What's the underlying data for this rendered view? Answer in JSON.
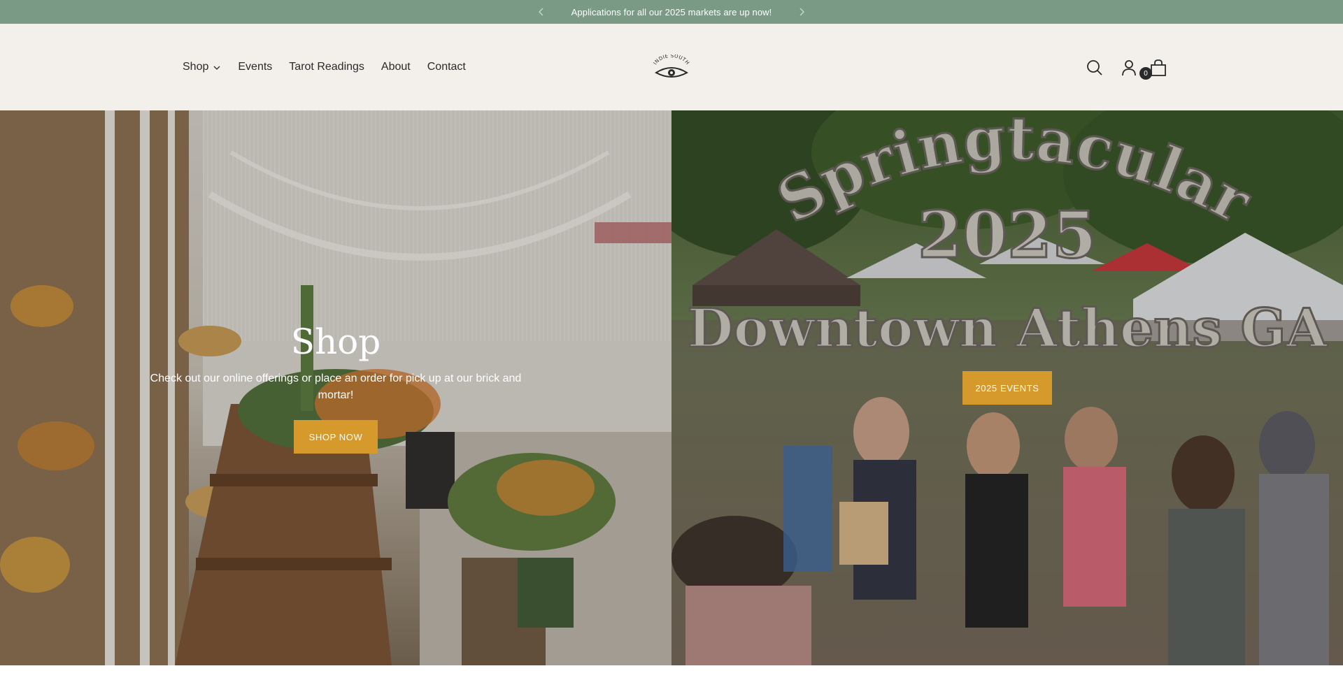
{
  "announcement": {
    "message": "Applications for all our 2025 markets are up now!",
    "prev_icon": "chevron-left-icon",
    "next_icon": "chevron-right-icon"
  },
  "header": {
    "nav": [
      {
        "label": "Shop",
        "has_dropdown": true
      },
      {
        "label": "Events"
      },
      {
        "label": "Tarot Readings"
      },
      {
        "label": "About"
      },
      {
        "label": "Contact"
      }
    ],
    "logo_text": "INDIE SOUTH",
    "icons": [
      "search-icon",
      "account-icon",
      "cart-icon"
    ],
    "cart_count": "0"
  },
  "hero": {
    "left": {
      "title": "Shop",
      "description": "Check out our online offerings or place an order for pick up at our brick and mortar!",
      "button_label": "SHOP NOW"
    },
    "right": {
      "image_text_line1": "Springtacular",
      "image_text_line2": "2025",
      "image_text_line3": "Downtown Athens GA",
      "button_label": "2025 EVENTS"
    }
  },
  "colors": {
    "announcement_bg": "#7a9a86",
    "header_bg": "#f3f0ec",
    "button_bg": "#d6992c"
  }
}
